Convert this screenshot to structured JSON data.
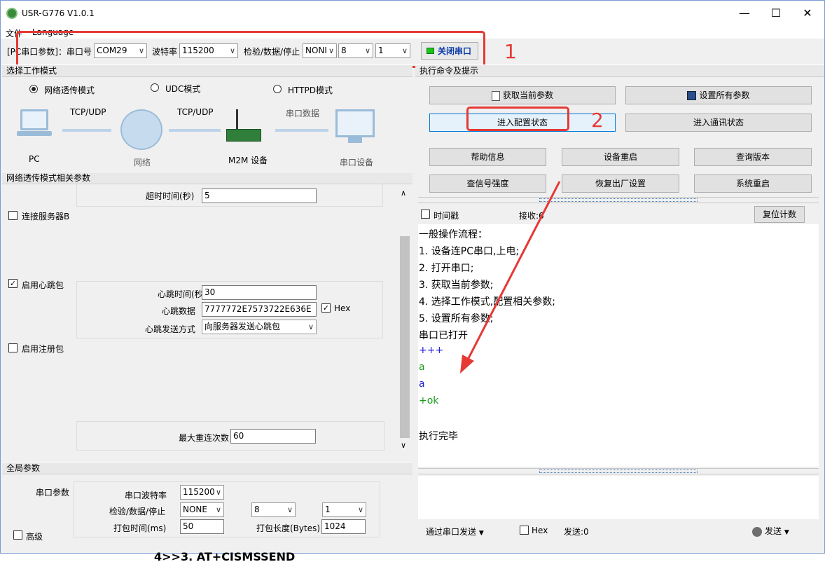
{
  "window": {
    "title": "USR-G776 V1.0.1",
    "minimize": "—",
    "maximize": "☐",
    "close": "✕"
  },
  "menu": {
    "file": "文件",
    "language": "Language"
  },
  "serial": {
    "label": "[PC串口参数]：串口号",
    "port": "COM29",
    "baud_label": "波特率",
    "baud": "115200",
    "parity_label": "检验/数据/停止",
    "parity": "NONI",
    "data_bits": "8",
    "stop_bits": "1",
    "close_button": "关闭串口"
  },
  "annotations": {
    "one": "1",
    "two": "2"
  },
  "mode_section": {
    "title": "选择工作模式",
    "net": "网络透传模式",
    "udc": "UDC模式",
    "httpd": "HTTPD模式"
  },
  "diagram": {
    "pc": "PC",
    "tcp1": "TCP/UDP",
    "network": "网络",
    "tcp2": "TCP/UDP",
    "m2m": "M2M 设备",
    "serial_data": "串口数据",
    "serial_device": "串口设备"
  },
  "net_params": {
    "title": "网络透传模式相关参数",
    "timeout_label": "超时时间(秒)",
    "timeout": "5",
    "connect_b": "连接服务器B",
    "heartbeat_enable": "启用心跳包",
    "hb_time_label": "心跳时间(秒",
    "hb_time": "30",
    "hb_data_label": "心跳数据",
    "hb_data": "7777772E7573722E636E",
    "hex": "Hex",
    "hb_mode_label": "心跳发送方式",
    "hb_mode": "向服务器发送心跳包",
    "register_enable": "启用注册包",
    "max_reconnect_label": "最大重连次数",
    "max_reconnect": "60"
  },
  "global": {
    "title": "全局参数",
    "serial_params": "串口参数",
    "baud_label": "串口波特率",
    "baud": "115200",
    "parity_label": "检验/数据/停止",
    "parity": "NONE",
    "data_bits": "8",
    "stop_bits": "1",
    "pack_time_label": "打包时间(ms)",
    "pack_time": "50",
    "pack_len_label": "打包长度(Bytes)",
    "pack_len": "1024",
    "advanced": "高级"
  },
  "cmd": {
    "title": "执行命令及提示",
    "get_params": "获取当前参数",
    "set_all": "设置所有参数",
    "enter_config": "进入配置状态",
    "enter_comm": "进入通讯状态",
    "help": "帮助信息",
    "restart_dev": "设备重启",
    "query_ver": "查询版本",
    "signal": "查信号强度",
    "factory": "恢复出厂设置",
    "sys_restart": "系统重启",
    "timestamp": "时间戳",
    "recv": "接收:6",
    "reset_count": "复位计数"
  },
  "log": [
    {
      "text": "一般操作流程：",
      "color": "#000000"
    },
    {
      "text": "1. 设备连PC串口,上电;",
      "color": "#000000"
    },
    {
      "text": "2. 打开串口;",
      "color": "#000000"
    },
    {
      "text": "3. 获取当前参数;",
      "color": "#000000"
    },
    {
      "text": "4. 选择工作模式,配置相关参数;",
      "color": "#000000"
    },
    {
      "text": "5. 设置所有参数;",
      "color": "#000000"
    },
    {
      "text": "串口已打开",
      "color": "#000000"
    },
    {
      "text": "+++",
      "color": "#1a1ad6"
    },
    {
      "text": "a",
      "color": "#1a9a1a"
    },
    {
      "text": "a",
      "color": "#1a1ad6"
    },
    {
      "text": "+ok",
      "color": "#1a9a1a"
    },
    {
      "text": "",
      "color": "#000000"
    },
    {
      "text": "执行完毕",
      "color": "#000000"
    }
  ],
  "send": {
    "via": "通过串口发送",
    "hex": "Hex",
    "sent": "发送:0",
    "send_button": "发送"
  },
  "background": {
    "text": "4>>3. AT+CISMSSEND"
  }
}
